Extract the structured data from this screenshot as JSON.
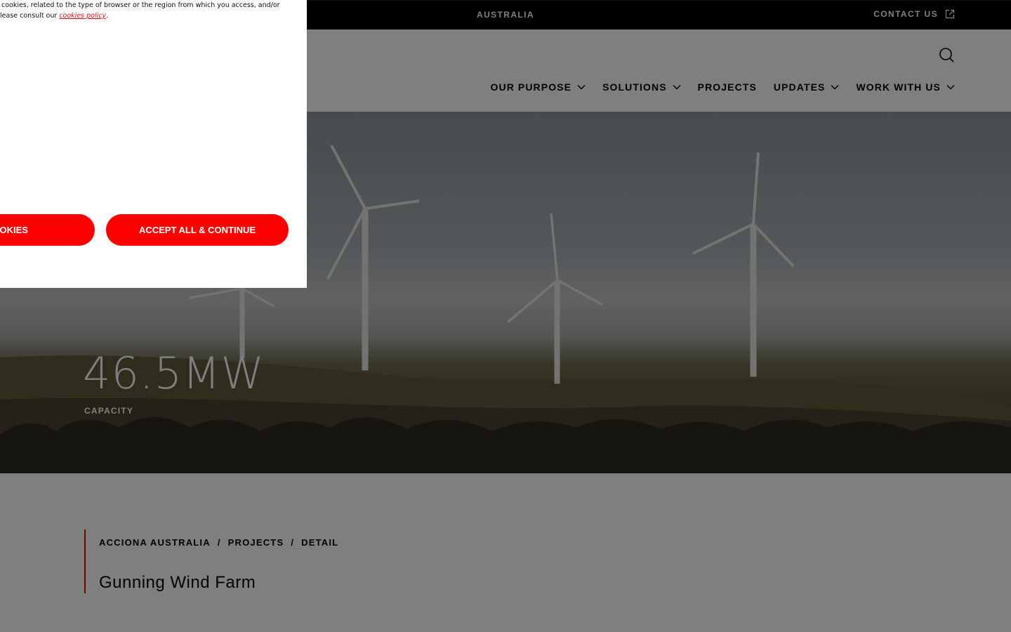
{
  "topbar": {
    "region": "AUSTRALIA",
    "contact_label": "CONTACT US",
    "contact_icon": "external-link-icon"
  },
  "header": {
    "search_icon": "search-icon",
    "nav": [
      {
        "label": "OUR PURPOSE",
        "has_dropdown": true
      },
      {
        "label": "SOLUTIONS",
        "has_dropdown": true
      },
      {
        "label": "PROJECTS",
        "has_dropdown": false
      },
      {
        "label": "UPDATES",
        "has_dropdown": true
      },
      {
        "label": "WORK WITH US",
        "has_dropdown": true
      }
    ]
  },
  "hero": {
    "stat_value": "46.5MW",
    "stat_label": "CAPACITY"
  },
  "breadcrumb": [
    "ACCIONA AUSTRALIA",
    "PROJECTS",
    "DETAIL"
  ],
  "page_title": "Gunning Wind Farm",
  "cookie_banner": {
    "text_line1": "s cookies, related to the type of browser or the region from which you access, and/or",
    "text_line2_prefix": " please consult our ",
    "policy_link": "cookies policy",
    "text_line2_suffix": ".",
    "reject_button": "COOKIES",
    "accept_button": "ACCEPT ALL & CONTINUE"
  },
  "colors": {
    "accent": "#e10b17",
    "button": "#ff0000",
    "topbar": "#000000"
  }
}
